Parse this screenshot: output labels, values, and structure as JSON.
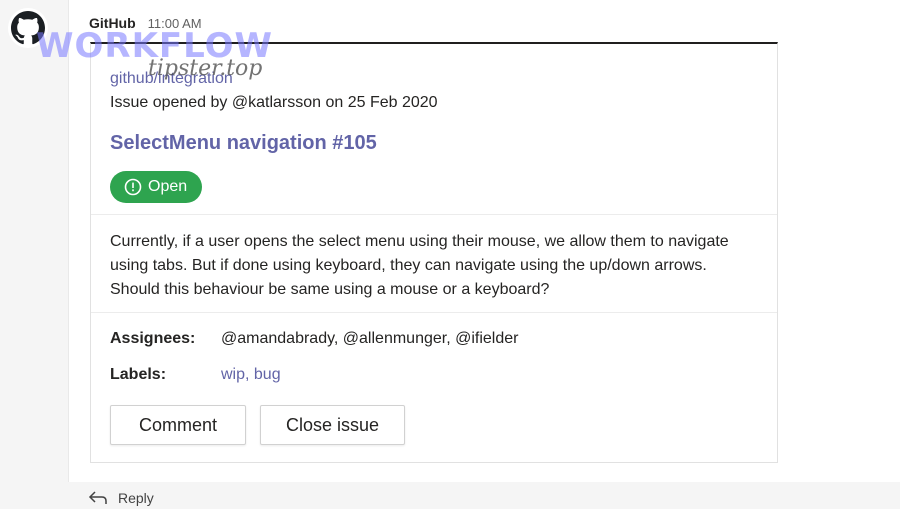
{
  "message": {
    "sender": "GitHub",
    "time": "11:00 AM"
  },
  "card": {
    "repo": "github/integration",
    "opened_line": "Issue opened by @katlarsson on 25 Feb 2020",
    "issue_title": "SelectMenu navigation #105",
    "status_label": "Open",
    "description": "Currently, if a user opens the select menu using their mouse, we allow them to navigate using tabs. But if done using keyboard, they can navigate using the up/down arrows. Should this behaviour be same using a mouse or a keyboard?",
    "assignees_label": "Assignees:",
    "assignees_value": "@amandabrady, @allenmunger, @ifielder",
    "labels_label": "Labels:",
    "labels_value": "wip, bug",
    "comment_button": "Comment",
    "close_button": "Close issue"
  },
  "reply_label": "Reply",
  "watermark": {
    "text": "WORKFLOW",
    "subtext": "tipster.top"
  },
  "colors": {
    "accent": "#6264a7",
    "open_badge": "#2ea44f"
  }
}
